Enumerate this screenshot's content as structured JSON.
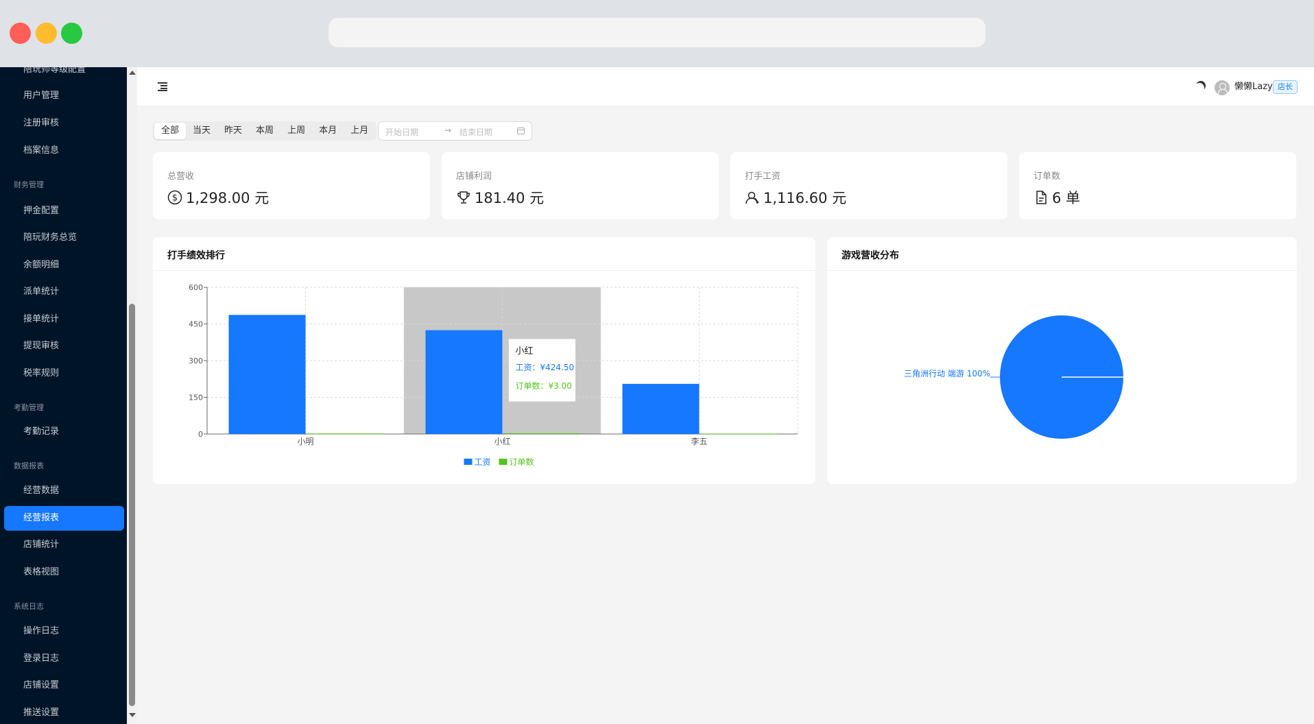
{
  "sidebar": {
    "items": [
      {
        "label": "陪玩师等级配置",
        "active": false
      },
      {
        "label": "用户管理",
        "active": false
      },
      {
        "label": "注册审核",
        "active": false
      },
      {
        "label": "档案信息",
        "active": false
      },
      {
        "label": "押金配置",
        "active": false
      },
      {
        "label": "陪玩财务总览",
        "active": false
      },
      {
        "label": "余额明细",
        "active": false
      },
      {
        "label": "派单统计",
        "active": false
      },
      {
        "label": "接单统计",
        "active": false
      },
      {
        "label": "提现审核",
        "active": false
      },
      {
        "label": "税率规则",
        "active": false
      },
      {
        "label": "考勤记录",
        "active": false
      },
      {
        "label": "经营数据",
        "active": false
      },
      {
        "label": "经营报表",
        "active": true
      },
      {
        "label": "店铺统计",
        "active": false
      },
      {
        "label": "表格视图",
        "active": false
      },
      {
        "label": "操作日志",
        "active": false
      },
      {
        "label": "登录日志",
        "active": false
      },
      {
        "label": "店铺设置",
        "active": false
      },
      {
        "label": "推送设置",
        "active": false
      }
    ],
    "groups": [
      "财务管理",
      "考勤管理",
      "数据报表",
      "系统日志"
    ]
  },
  "header": {
    "user_name": "懒懒Lazy",
    "role": "店长"
  },
  "filters": {
    "periods": [
      "全部",
      "当天",
      "昨天",
      "本周",
      "上周",
      "本月",
      "上月"
    ],
    "active_period": "全部",
    "start_placeholder": "开始日期",
    "end_placeholder": "结束日期",
    "separator": "→"
  },
  "stats": [
    {
      "title": "总营收",
      "value": "1,298.00 元",
      "icon": "dollar-circle-icon"
    },
    {
      "title": "店铺利润",
      "value": "181.40 元",
      "icon": "trophy-icon"
    },
    {
      "title": "打手工资",
      "value": "1,116.60 元",
      "icon": "users-icon"
    },
    {
      "title": "订单数",
      "value": "6 单",
      "icon": "file-icon"
    }
  ],
  "performance_card": {
    "title": "打手绩效排行"
  },
  "revenue_card": {
    "title": "游戏营收分布"
  },
  "chart_data": [
    {
      "type": "bar",
      "title": "打手绩效排行",
      "categories": [
        "小明",
        "小红",
        "李五"
      ],
      "series": [
        {
          "name": "工资",
          "values": [
            487.0,
            424.5,
            205.1
          ],
          "color": "#1677ff"
        },
        {
          "name": "订单数",
          "values": [
            2,
            3,
            1
          ],
          "color": "#52c41a"
        }
      ],
      "yticks": [
        "600",
        "450",
        "300",
        "150",
        "0"
      ],
      "ylim": [
        0,
        600
      ],
      "grid": true,
      "legend": "bottom",
      "highlighted_category": "小红",
      "tooltip": {
        "title": "小红",
        "lines": [
          {
            "text": "工资：¥424.50",
            "color": "#1677ff"
          },
          {
            "text": "订单数：¥3.00",
            "color": "#52c41a"
          }
        ]
      }
    },
    {
      "type": "pie",
      "title": "游戏营收分布",
      "slices": [
        {
          "label": "三角洲行动 端游 100%",
          "value": 100,
          "color": "#1677ff"
        }
      ]
    }
  ]
}
